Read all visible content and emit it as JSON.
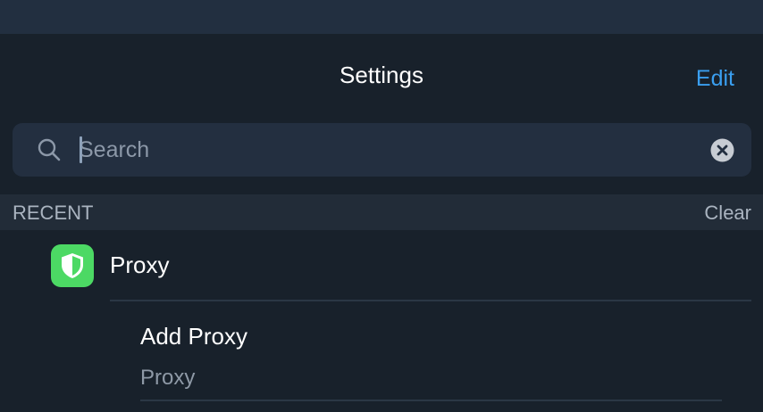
{
  "nav": {
    "title": "Settings",
    "edit_label": "Edit"
  },
  "search": {
    "placeholder": "Search",
    "value": ""
  },
  "recent": {
    "header": "RECENT",
    "clear_label": "Clear",
    "items": [
      {
        "label": "Proxy",
        "icon": "shield-icon",
        "icon_bg": "#4cd964"
      }
    ],
    "results": [
      {
        "title": "Add Proxy",
        "subtitle": "Proxy"
      }
    ]
  },
  "colors": {
    "accent": "#3a9ff0",
    "background": "#18212b",
    "surface": "#232f40",
    "icon_green": "#4cd964"
  }
}
